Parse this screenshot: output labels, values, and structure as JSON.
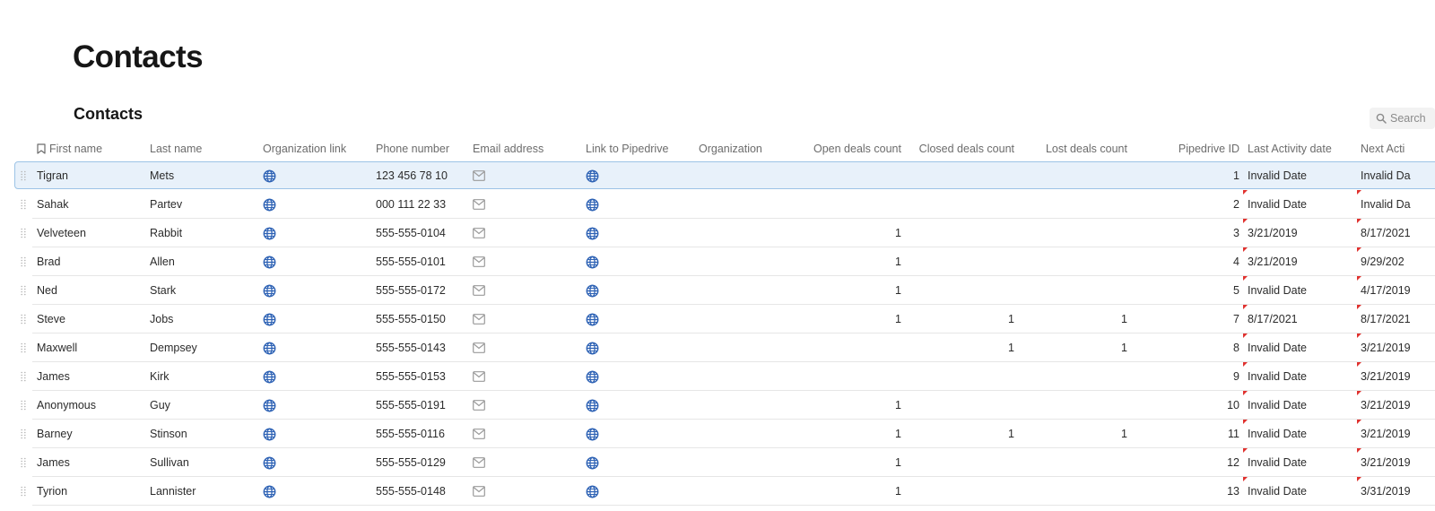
{
  "page": {
    "title": "Contacts"
  },
  "table": {
    "title": "Contacts",
    "search_label": "Search",
    "columns": [
      {
        "key": "first_name",
        "label": "First name"
      },
      {
        "key": "last_name",
        "label": "Last name"
      },
      {
        "key": "org_link",
        "label": "Organization link"
      },
      {
        "key": "phone",
        "label": "Phone number"
      },
      {
        "key": "email",
        "label": "Email address"
      },
      {
        "key": "pipedrive_link",
        "label": "Link to Pipedrive"
      },
      {
        "key": "organization",
        "label": "Organization"
      },
      {
        "key": "open_deals",
        "label": "Open deals count"
      },
      {
        "key": "closed_deals",
        "label": "Closed deals count"
      },
      {
        "key": "lost_deals",
        "label": "Lost deals count"
      },
      {
        "key": "pipedrive_id",
        "label": "Pipedrive ID"
      },
      {
        "key": "last_activity",
        "label": "Last Activity date"
      },
      {
        "key": "next_activity",
        "label": "Next Acti"
      }
    ],
    "rows": [
      {
        "first_name": "Tigran",
        "last_name": "Mets",
        "phone": "123 456 78 10",
        "organization": "",
        "open_deals": "",
        "closed_deals": "",
        "lost_deals": "",
        "pipedrive_id": "1",
        "last_activity": "Invalid Date",
        "next_activity": "Invalid Da",
        "selected": true
      },
      {
        "first_name": "Sahak",
        "last_name": "Partev",
        "phone": "000 111 22 33",
        "organization": "",
        "open_deals": "",
        "closed_deals": "",
        "lost_deals": "",
        "pipedrive_id": "2",
        "last_activity": "Invalid Date",
        "next_activity": "Invalid Da"
      },
      {
        "first_name": "Velveteen",
        "last_name": "Rabbit",
        "phone": "555-555-0104",
        "organization": "",
        "open_deals": "1",
        "closed_deals": "",
        "lost_deals": "",
        "pipedrive_id": "3",
        "last_activity": "3/21/2019",
        "next_activity": "8/17/2021"
      },
      {
        "first_name": "Brad",
        "last_name": "Allen",
        "phone": "555-555-0101",
        "organization": "",
        "open_deals": "1",
        "closed_deals": "",
        "lost_deals": "",
        "pipedrive_id": "4",
        "last_activity": "3/21/2019",
        "next_activity": "9/29/202"
      },
      {
        "first_name": "Ned",
        "last_name": "Stark",
        "phone": "555-555-0172",
        "organization": "",
        "open_deals": "1",
        "closed_deals": "",
        "lost_deals": "",
        "pipedrive_id": "5",
        "last_activity": "Invalid Date",
        "next_activity": "4/17/2019"
      },
      {
        "first_name": "Steve",
        "last_name": "Jobs",
        "phone": "555-555-0150",
        "organization": "",
        "open_deals": "1",
        "closed_deals": "1",
        "lost_deals": "1",
        "pipedrive_id": "7",
        "last_activity": "8/17/2021",
        "next_activity": "8/17/2021"
      },
      {
        "first_name": "Maxwell",
        "last_name": "Dempsey",
        "phone": "555-555-0143",
        "organization": "",
        "open_deals": "",
        "closed_deals": "1",
        "lost_deals": "1",
        "pipedrive_id": "8",
        "last_activity": "Invalid Date",
        "next_activity": "3/21/2019"
      },
      {
        "first_name": "James",
        "last_name": "Kirk",
        "phone": "555-555-0153",
        "organization": "",
        "open_deals": "",
        "closed_deals": "",
        "lost_deals": "",
        "pipedrive_id": "9",
        "last_activity": "Invalid Date",
        "next_activity": "3/21/2019"
      },
      {
        "first_name": "Anonymous",
        "last_name": "Guy",
        "phone": "555-555-0191",
        "organization": "",
        "open_deals": "1",
        "closed_deals": "",
        "lost_deals": "",
        "pipedrive_id": "10",
        "last_activity": "Invalid Date",
        "next_activity": "3/21/2019"
      },
      {
        "first_name": "Barney",
        "last_name": "Stinson",
        "phone": "555-555-0116",
        "organization": "",
        "open_deals": "1",
        "closed_deals": "1",
        "lost_deals": "1",
        "pipedrive_id": "11",
        "last_activity": "Invalid Date",
        "next_activity": "3/21/2019"
      },
      {
        "first_name": "James",
        "last_name": "Sullivan",
        "phone": "555-555-0129",
        "organization": "",
        "open_deals": "1",
        "closed_deals": "",
        "lost_deals": "",
        "pipedrive_id": "12",
        "last_activity": "Invalid Date",
        "next_activity": "3/21/2019"
      },
      {
        "first_name": "Tyrion",
        "last_name": "Lannister",
        "phone": "555-555-0148",
        "organization": "",
        "open_deals": "1",
        "closed_deals": "",
        "lost_deals": "",
        "pipedrive_id": "13",
        "last_activity": "Invalid Date",
        "next_activity": "3/31/2019"
      }
    ],
    "icons": {
      "org_link": "globe-icon",
      "email": "mail-icon",
      "pipedrive_link": "globe-icon",
      "first_name_header": "bookmark-icon",
      "drag": "drag-handle-icon",
      "search": "search-icon"
    }
  },
  "colors": {
    "link_icon": "#2f63b5",
    "selected_row": "#e8f1fa",
    "selected_border": "#9cc3e6",
    "cell_marker": "#e0312e"
  }
}
